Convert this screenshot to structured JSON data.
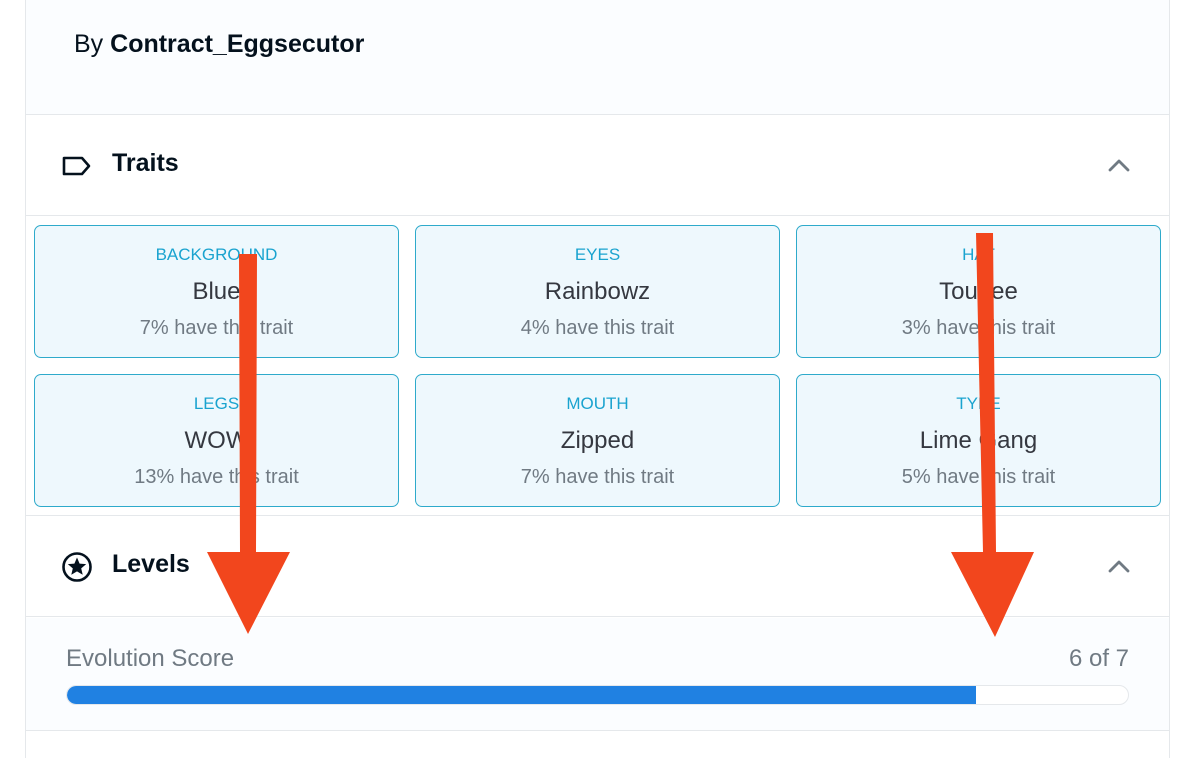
{
  "byline": {
    "prefix": "By",
    "creator": "Contract_Eggsecutor"
  },
  "traits_section": {
    "title": "Traits",
    "icon": "tag-icon"
  },
  "traits": [
    {
      "type": "BACKGROUND",
      "value": "Blue",
      "rarity": "7% have this trait"
    },
    {
      "type": "EYES",
      "value": "Rainbowz",
      "rarity": "4% have this trait"
    },
    {
      "type": "HAT",
      "value": "Toupee",
      "rarity": "3% have this trait"
    },
    {
      "type": "LEGS",
      "value": "WOW",
      "rarity": "13% have this trait"
    },
    {
      "type": "MOUTH",
      "value": "Zipped",
      "rarity": "7% have this trait"
    },
    {
      "type": "TYPE",
      "value": "Lime Gang",
      "rarity": "5% have this trait"
    }
  ],
  "levels_section": {
    "title": "Levels",
    "icon": "star-icon"
  },
  "levels": [
    {
      "name": "Evolution Score",
      "value_text": "6 of 7",
      "value": 6,
      "max": 7
    }
  ],
  "colors": {
    "accent": "#2081e2",
    "trait_border": "#2eaacb",
    "trait_bg": "#eef8fd",
    "arrow": "#f2461d"
  }
}
